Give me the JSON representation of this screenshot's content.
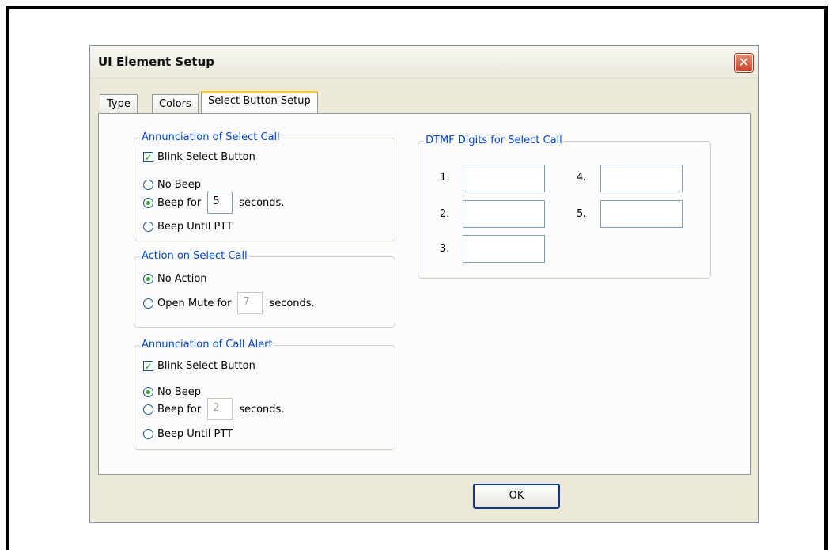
{
  "dialog": {
    "title": "UI Element Setup",
    "close_glyph": "✕"
  },
  "tabs": [
    {
      "label": "Type",
      "active": false
    },
    {
      "label": "Colors",
      "active": false
    },
    {
      "label": "Select Button Setup",
      "active": true
    }
  ],
  "annunciation_select": {
    "label": "Annunciation of Select Call",
    "blink_label": "Blink Select Button",
    "blink_checked": true,
    "no_beep_label": "No Beep",
    "beep_for_label": "Beep for",
    "beep_seconds": "5",
    "seconds_label": "seconds.",
    "beep_until_label": "Beep Until PTT",
    "selected": "beep_for"
  },
  "action_select": {
    "label": "Action on Select Call",
    "no_action_label": "No Action",
    "open_mute_label": "Open Mute for",
    "open_mute_seconds": "7",
    "seconds_label": "seconds.",
    "selected": "no_action"
  },
  "annunciation_alert": {
    "label": "Annunciation of Call Alert",
    "blink_label": "Blink Select Button",
    "blink_checked": true,
    "no_beep_label": "No Beep",
    "beep_for_label": "Beep for",
    "beep_seconds": "2",
    "seconds_label": "seconds.",
    "beep_until_label": "Beep Until PTT",
    "selected": "no_beep"
  },
  "dtmf": {
    "label": "DTMF Digits for Select Call",
    "digits": [
      {
        "label": "1.",
        "value": ""
      },
      {
        "label": "2.",
        "value": ""
      },
      {
        "label": "3.",
        "value": ""
      },
      {
        "label": "4.",
        "value": ""
      },
      {
        "label": "5.",
        "value": ""
      }
    ]
  },
  "ok_label": "OK",
  "colors": {
    "group_label": "#0046d5",
    "radio_dot": "#21a121",
    "close_red": "#c6432a"
  }
}
